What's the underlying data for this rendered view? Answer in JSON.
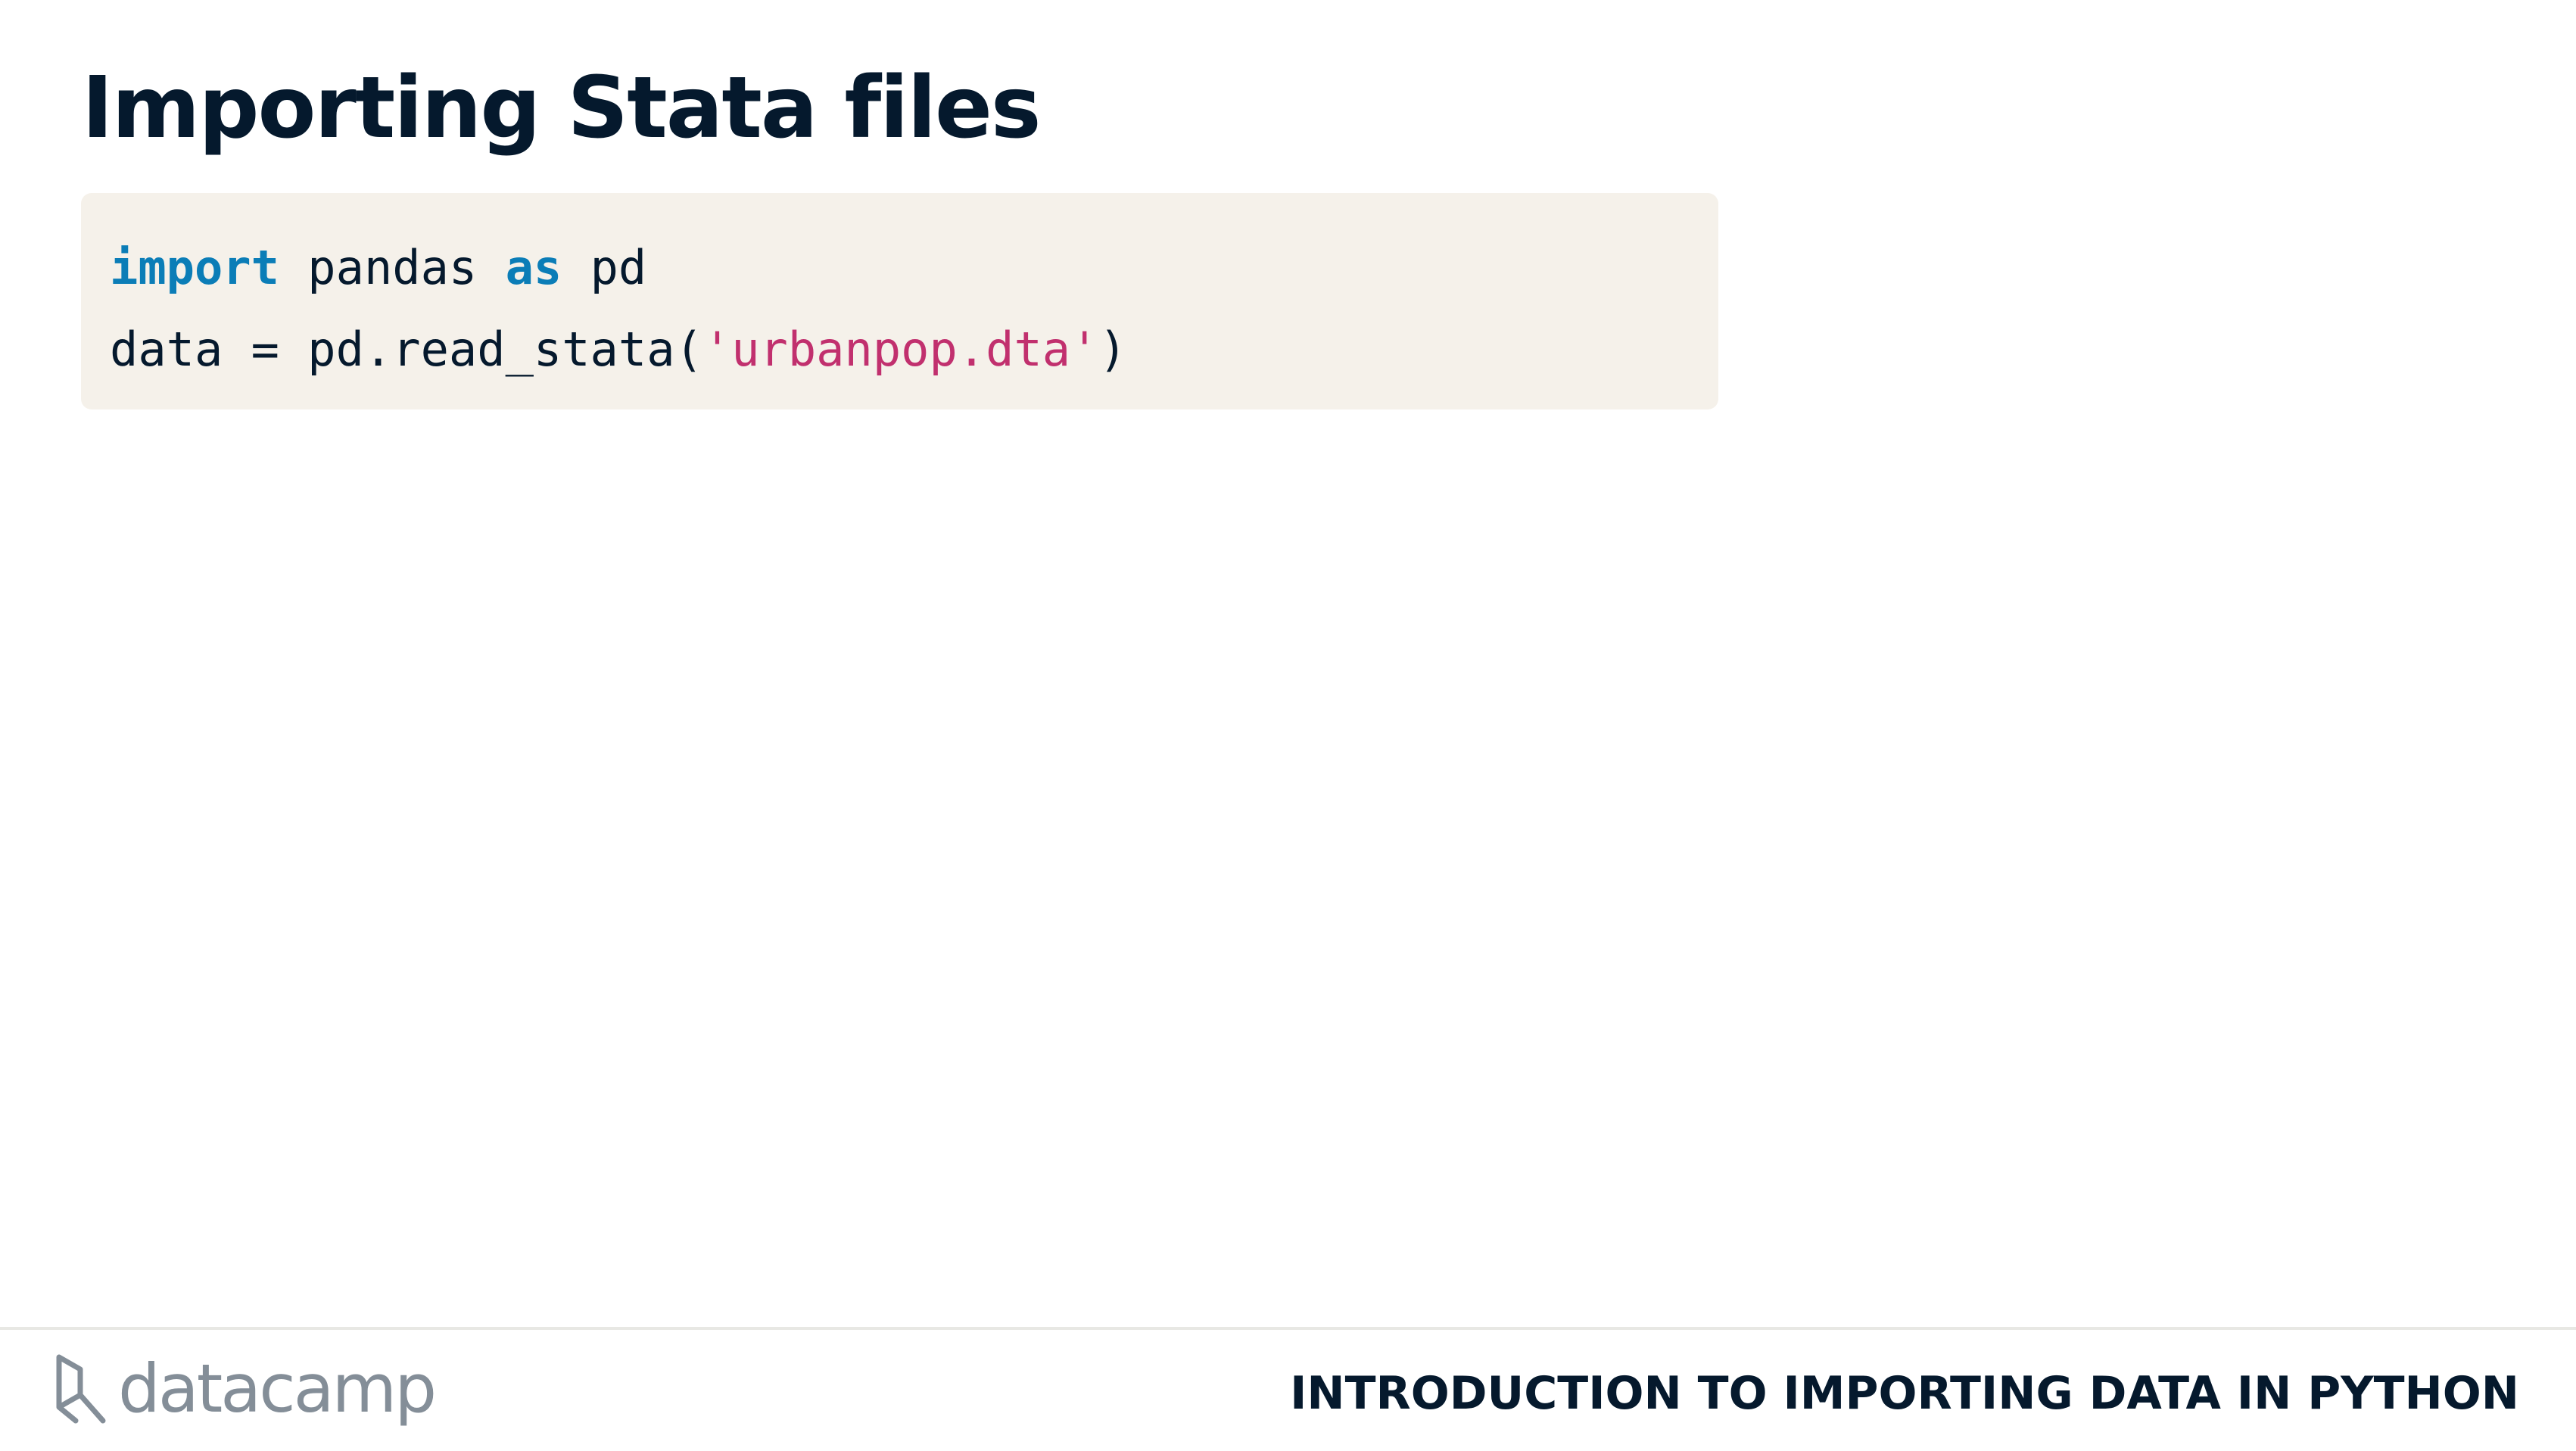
{
  "slide": {
    "title": "Importing Stata files"
  },
  "code": {
    "line1": {
      "kw1": "import",
      "t1": " pandas ",
      "kw2": "as",
      "t2": " pd"
    },
    "line2": {
      "t1": "data = pd.read_stata(",
      "str": "'urbanpop.dta'",
      "t2": ")"
    },
    "colors": {
      "background": "#f5f1ea",
      "keyword": "#0b7db7",
      "string": "#c1306e",
      "text": "#05192d"
    }
  },
  "footer": {
    "logo_text": "datacamp",
    "logo_icon": "datacamp-logo-icon",
    "course_title": "INTRODUCTION TO IMPORTING DATA IN PYTHON"
  }
}
